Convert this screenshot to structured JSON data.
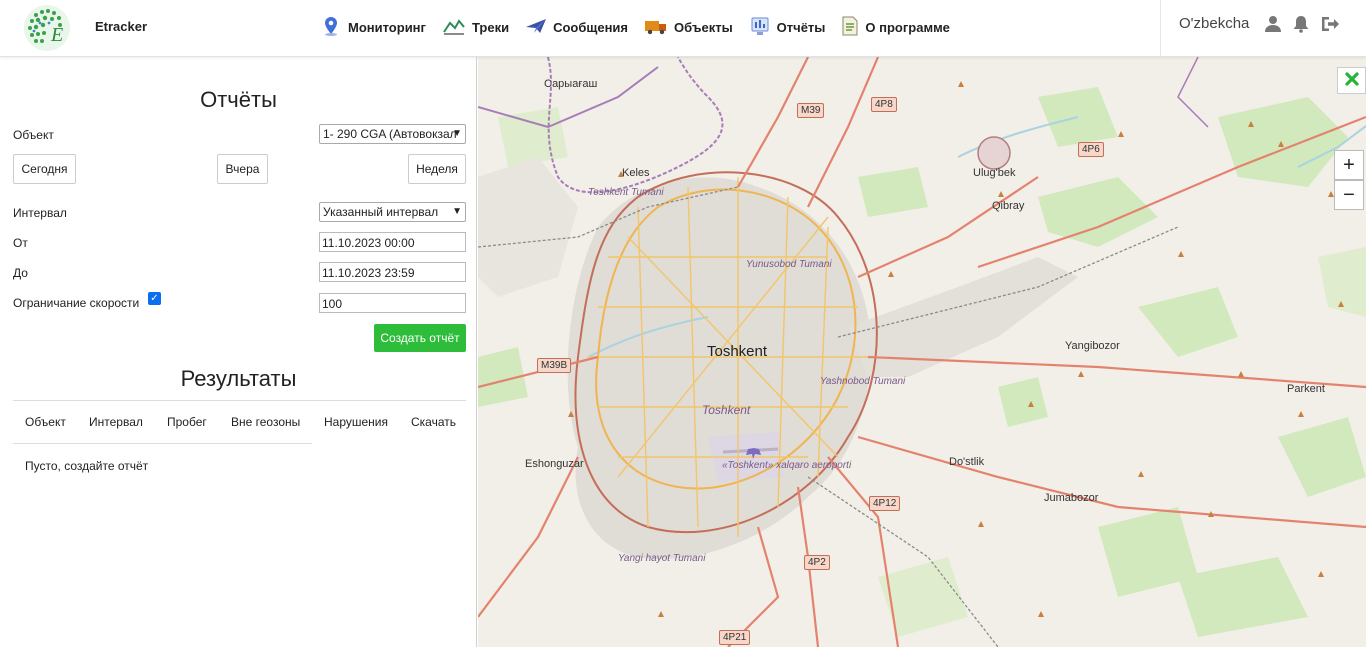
{
  "header": {
    "brand": "Etracker",
    "logo_text": "Etracker",
    "nav": [
      {
        "label": "Мониторинг",
        "icon": "map-pin-icon"
      },
      {
        "label": "Треки",
        "icon": "tracks-icon"
      },
      {
        "label": "Сообщения",
        "icon": "plane-message-icon"
      },
      {
        "label": "Объекты",
        "icon": "truck-icon"
      },
      {
        "label": "Отчёты",
        "icon": "report-icon"
      },
      {
        "label": "О программе",
        "icon": "document-icon"
      }
    ],
    "language": "O'zbekcha",
    "icons": [
      "user-icon",
      "bell-icon",
      "logout-icon"
    ]
  },
  "panel": {
    "title": "Отчёты",
    "object_label": "Объект",
    "object_value": "1- 290 CGA (Автовокзал",
    "quick_buttons": [
      "Сегодня",
      "Вчера",
      "Неделя"
    ],
    "interval_label": "Интервал",
    "interval_value": "Указанный интервал",
    "from_label": "От",
    "from_value": "11.10.2023 00:00",
    "to_label": "До",
    "to_value": "11.10.2023 23:59",
    "speed_label": "Ограничание скорости",
    "speed_checked": true,
    "speed_value": "100",
    "create_button": "Создать отчёт",
    "results_title": "Результаты",
    "columns": [
      "Объект",
      "Интервал",
      "Пробег",
      "Вне геозоны",
      "Нарушения",
      "Скачать"
    ],
    "empty_text": "Пусто, создайте отчёт"
  },
  "map": {
    "places": [
      "Sarыағаш",
      "Keles",
      "Toshkent Tumani",
      "Yunusobod Tumani",
      "Ulug'bek",
      "Qibray",
      "Toshkent",
      "Yashnobod Tumani",
      "Toshkent",
      "«Toshkent» xalqaro aeroporti",
      "Eshonguzar",
      "Yangibozor",
      "Parkent",
      "Do'stlik",
      "Jumabozor",
      "Yangi hayot Tumani"
    ],
    "place_top_left": "Сарыағаш",
    "roads": [
      "M39",
      "4P8",
      "4P6",
      "M39B",
      "4P12",
      "4P2",
      "4P21"
    ],
    "zoom_in": "+",
    "zoom_out": "−",
    "city_label": "Toshkent",
    "city_label_italic": "Toshkent",
    "keles": "Keles",
    "toshkent_tumani": "Toshkent Tumani",
    "yunusobod": "Yunusobod Tumani",
    "ulugbek": "Ulug'bek",
    "qibray": "Qibray",
    "yashnobod": "Yashnobod Tumani",
    "airport": "«Toshkent» xalqaro aeroporti",
    "eshonguzar": "Eshonguzar",
    "yangibozor": "Yangibozor",
    "parkent": "Parkent",
    "dostlik": "Do'stlik",
    "jumabozor": "Jumabozor",
    "yangi_hayot": "Yangi hayot Tumani",
    "r_m39": "M39",
    "r_4p8": "4P8",
    "r_4p6": "4P6",
    "r_m39b": "M39B",
    "r_4p12": "4P12",
    "r_4p2": "4P2",
    "r_4p21": "4P21"
  }
}
